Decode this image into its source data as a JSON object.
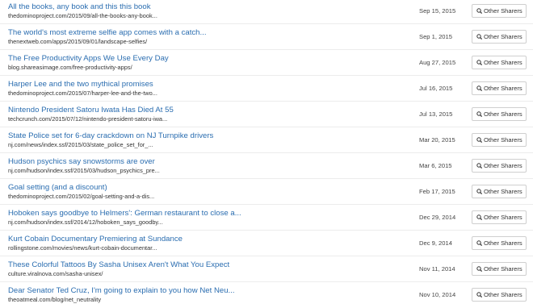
{
  "rows": [
    {
      "title": "All the books, any book and this this book",
      "url": "thedominoproject.com/2015/09/all-the-books-any-book...",
      "date": "Sep 15, 2015",
      "button": "Other Sharers"
    },
    {
      "title": "The world's most extreme selfie app comes with a catch...",
      "url": "thenextweb.com/apps/2015/09/01/landscape-selfies/",
      "date": "Sep 1, 2015",
      "button": "Other Sharers"
    },
    {
      "title": "The Free Productivity Apps We Use Every Day",
      "url": "blog.shareasimage.com/free-productivity-apps/",
      "date": "Aug 27, 2015",
      "button": "Other Sharers"
    },
    {
      "title": "Harper Lee and the two mythical promises",
      "url": "thedominoproject.com/2015/07/harper-lee-and-the-two...",
      "date": "Jul 16, 2015",
      "button": "Other Sharers"
    },
    {
      "title": "Nintendo President Satoru Iwata Has Died At 55",
      "url": "techcrunch.com/2015/07/12/nintendo-president-satoru-iwa...",
      "date": "Jul 13, 2015",
      "button": "Other Sharers"
    },
    {
      "title": "State Police set for 6-day crackdown on NJ Turnpike drivers",
      "url": "nj.com/news/index.ssf/2015/03/state_police_set_for_...",
      "date": "Mar 20, 2015",
      "button": "Other Sharers"
    },
    {
      "title": "Hudson psychics say snowstorms are over",
      "url": "nj.com/hudson/index.ssf/2015/03/hudson_psychics_pre...",
      "date": "Mar 6, 2015",
      "button": "Other Sharers"
    },
    {
      "title": "Goal setting (and a discount)",
      "url": "thedominoproject.com/2015/02/goal-setting-and-a-dis...",
      "date": "Feb 17, 2015",
      "button": "Other Sharers"
    },
    {
      "title": "Hoboken says goodbye to Helmers': German restaurant to close a...",
      "url": "nj.com/hudson/index.ssf/2014/12/hoboken_says_goodby...",
      "date": "Dec 29, 2014",
      "button": "Other Sharers"
    },
    {
      "title": "Kurt Cobain Documentary Premiering at Sundance",
      "url": "rollingstone.com/movies/news/kurt-cobain-documentar...",
      "date": "Dec 9, 2014",
      "button": "Other Sharers"
    },
    {
      "title": "These Colorful Tattoos By Sasha Unisex Aren't What You Expect",
      "url": "culture.viralnova.com/sasha-unisex/",
      "date": "Nov 11, 2014",
      "button": "Other Sharers"
    },
    {
      "title": "Dear Senator Ted Cruz, I'm going to explain to you how Net Neu...",
      "url": "theoatmeal.com/blog/net_neutrality",
      "date": "Nov 10, 2014",
      "button": "Other Sharers"
    }
  ],
  "colors": {
    "link": "#2a6db0",
    "text": "#333333",
    "border": "#cfcfcf"
  },
  "icons": {
    "button": "search-icon"
  }
}
